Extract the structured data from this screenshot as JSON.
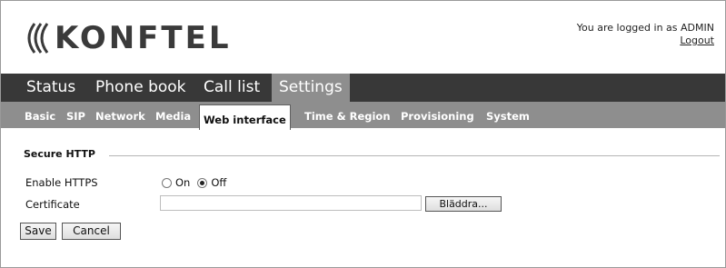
{
  "logo": {
    "text": "KONFTEL"
  },
  "session": {
    "logged_in_text": "You are logged in as ADMIN",
    "logout_label": "Logout"
  },
  "main_tabs": [
    {
      "label": "Status",
      "active": false
    },
    {
      "label": "Phone book",
      "active": false
    },
    {
      "label": "Call list",
      "active": false
    },
    {
      "label": "Settings",
      "active": true
    }
  ],
  "sub_tabs": [
    {
      "label": "Basic",
      "active": false
    },
    {
      "label": "SIP",
      "active": false
    },
    {
      "label": "Network",
      "active": false
    },
    {
      "label": "Media",
      "active": false
    },
    {
      "label": "Web interface",
      "active": true
    },
    {
      "label": "Time & Region",
      "active": false
    },
    {
      "label": "Provisioning",
      "active": false
    },
    {
      "label": "System",
      "active": false
    }
  ],
  "form": {
    "section_title": "Secure HTTP",
    "enable_https_label": "Enable HTTPS",
    "on_label": "On",
    "off_label": "Off",
    "https_value": "Off",
    "certificate_label": "Certificate",
    "certificate_value": "",
    "browse_label": "Bläddra..."
  },
  "actions": {
    "save_label": "Save",
    "cancel_label": "Cancel"
  }
}
